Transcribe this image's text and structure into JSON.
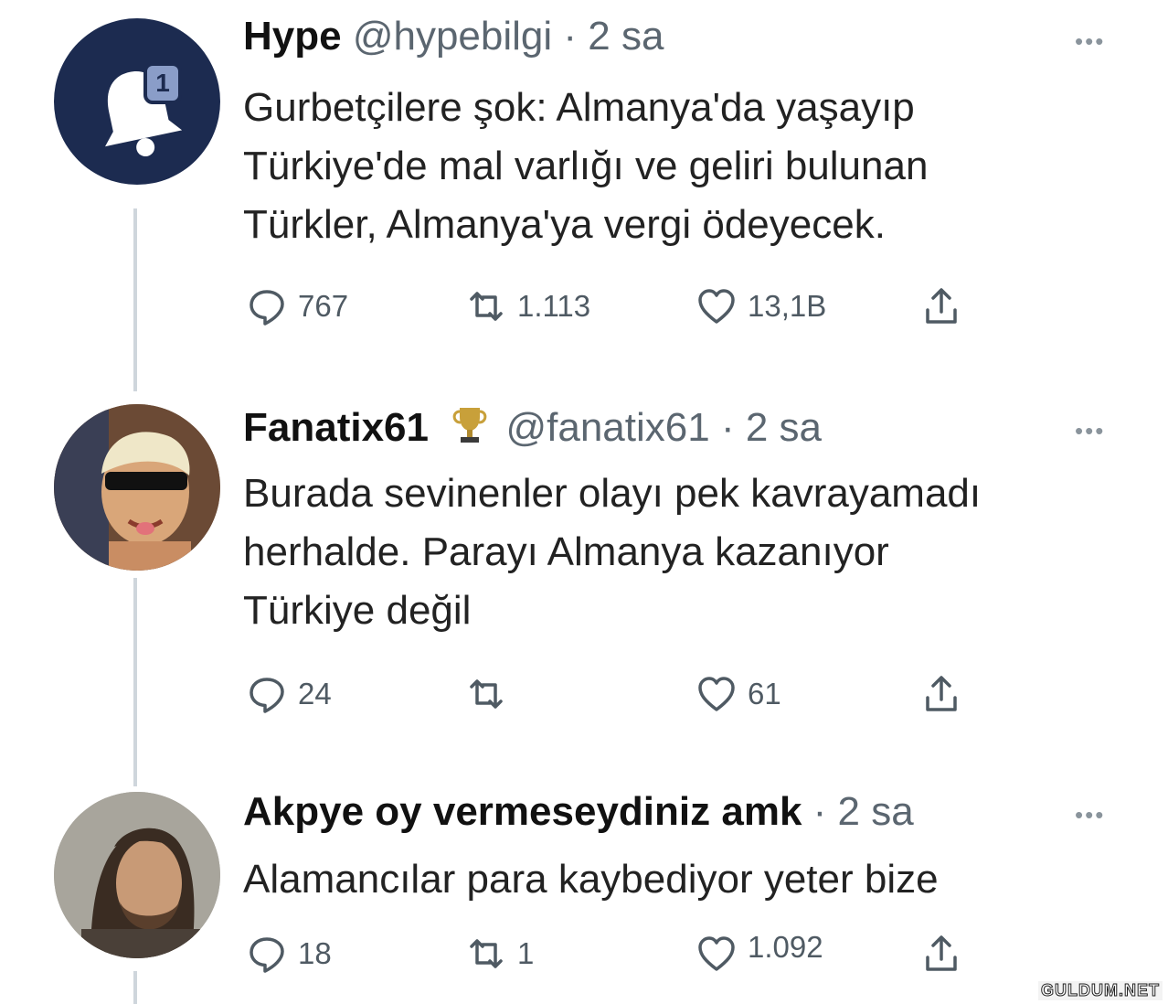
{
  "tweets": [
    {
      "name": "Hype",
      "handle": "@hypebilgi",
      "time": "· 2 sa",
      "lines": [
        "Gurbetçilere şok: Almanya'da yaşayıp",
        "Türkiye'de mal varlığı ve geliri bulunan",
        "Türkler, Almanya'ya vergi ödeyecek."
      ],
      "replies": "767",
      "retweets": "1.113",
      "likes": "13,1B",
      "avatar": {
        "badge": "1",
        "icon": "bell-icon",
        "bg": "#1c2b50"
      }
    },
    {
      "name": "Fanatix61",
      "badge_icon": "trophy-icon",
      "handle": "@fanatix61",
      "time": "· 2 sa",
      "lines": [
        "Burada sevinenler olayı pek kavrayamadı",
        "herhalde. Parayı Almanya kazanıyor",
        "Türkiye değil"
      ],
      "replies": "24",
      "retweets": "",
      "likes": "61",
      "avatar": {
        "icon": "profile-photo"
      }
    },
    {
      "name": "Akpye oy vermeseydiniz amk",
      "handle": "",
      "time": "· 2 sa",
      "lines": [
        "Alamancılar para kaybediyor yeter bize"
      ],
      "replies": "18",
      "retweets": "1",
      "likes": "1.092",
      "avatar": {
        "icon": "profile-photo"
      }
    }
  ],
  "more_label": "•••",
  "watermark": "GULDUM.NET",
  "colors": {
    "thread_line": "#cfd6dc",
    "meta_text": "#5b6670",
    "avatar_bg": "#1c2b50"
  }
}
